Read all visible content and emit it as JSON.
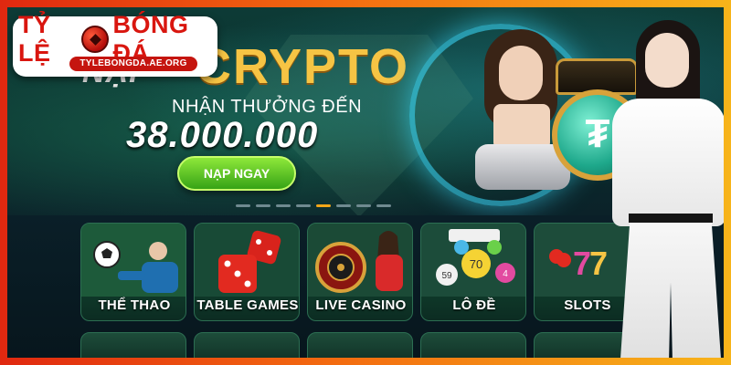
{
  "logo": {
    "title_left": "TỶ LỆ",
    "title_right": "BÓNG ĐÁ",
    "domain": "TYLEBONGDA.AE.ORG"
  },
  "banner": {
    "prefix": "NẠP",
    "headline": "CRYPTO",
    "promo_line": "NHẬN THƯỞNG ĐẾN",
    "amount": "38.000.000",
    "cta": "NẠP NGAY",
    "slide_count": 8,
    "active_slide": 4,
    "coin_symbol": "₮"
  },
  "categories": [
    {
      "label": "THỂ THAO",
      "icon": "soccer-ball-icon"
    },
    {
      "label": "TABLE GAMES",
      "icon": "dice-icon"
    },
    {
      "label": "LIVE CASINO",
      "icon": "roulette-icon"
    },
    {
      "label": "LÔ ĐỀ",
      "icon": "lottery-balls-icon"
    },
    {
      "label": "SLOTS",
      "icon": "slot-machine-icon"
    }
  ],
  "colors": {
    "accent_orange": "#f2a618",
    "brand_red": "#d9160f",
    "cta_green": "#36a316",
    "crypto_gold": "#f6c444"
  }
}
